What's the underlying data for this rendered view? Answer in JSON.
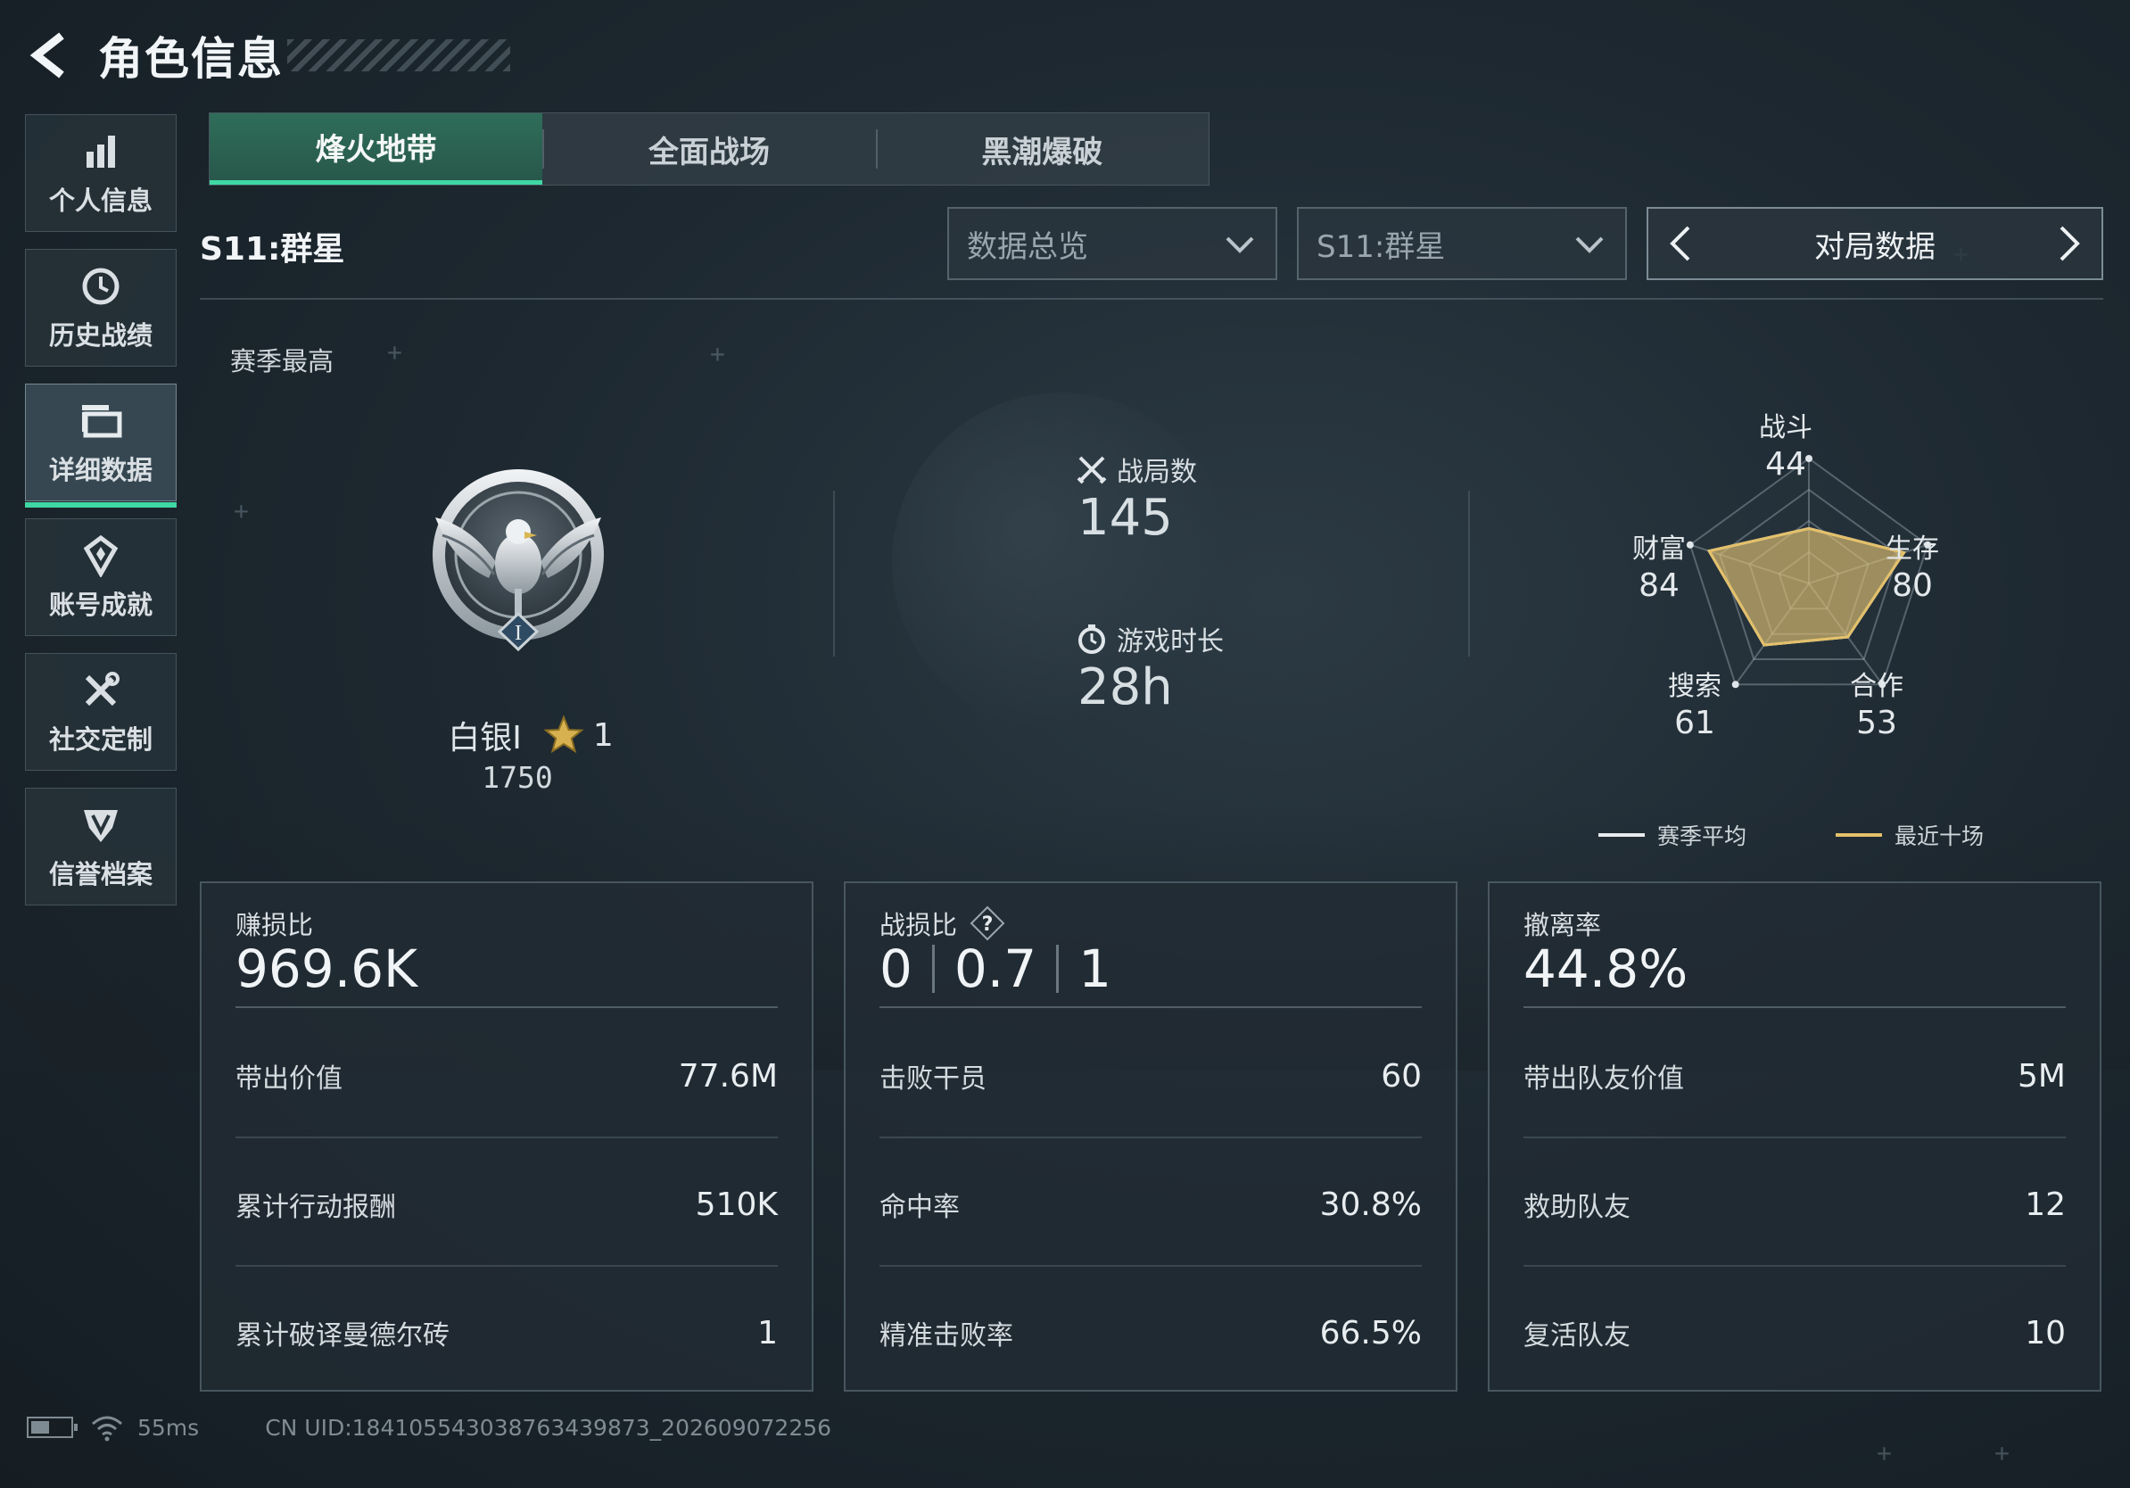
{
  "header": {
    "title": "角色信息"
  },
  "sidebar": {
    "items": [
      {
        "label": "个人信息",
        "icon": "bar-chart-icon"
      },
      {
        "label": "历史战绩",
        "icon": "history-clock-icon"
      },
      {
        "label": "详细数据",
        "icon": "folder-icon",
        "active": true
      },
      {
        "label": "账号成就",
        "icon": "achievement-icon"
      },
      {
        "label": "社交定制",
        "icon": "tools-icon"
      },
      {
        "label": "信誉档案",
        "icon": "shield-emblem-icon"
      }
    ]
  },
  "tabs": [
    {
      "label": "烽火地带",
      "active": true
    },
    {
      "label": "全面战场"
    },
    {
      "label": "黑潮爆破"
    }
  ],
  "filters": {
    "season_title": "S11:群星",
    "overview_dropdown": "数据总览",
    "season_dropdown": "S11:群星",
    "pager_label": "对局数据"
  },
  "summary": {
    "season_best_label": "赛季最高",
    "rank_name": "白银I",
    "rank_stars": "1",
    "rank_score": "1750",
    "matches_label": "战局数",
    "matches_value": "145",
    "playtime_label": "游戏时长",
    "playtime_value": "28h"
  },
  "radar": {
    "axes": [
      {
        "name": "战斗",
        "value": "44"
      },
      {
        "name": "生存",
        "value": "80"
      },
      {
        "name": "合作",
        "value": "53"
      },
      {
        "name": "搜索",
        "value": "61"
      },
      {
        "name": "财富",
        "value": "84"
      }
    ],
    "legend": {
      "season_avg": "赛季平均",
      "recent_ten": "最近十场"
    },
    "colors": {
      "season_avg": "#e8ecef",
      "recent_ten": "#e3c06a"
    }
  },
  "cards": {
    "profit": {
      "title": "赚损比",
      "value": "969.6K",
      "rows": [
        {
          "label": "带出价值",
          "value": "77.6M"
        },
        {
          "label": "累计行动报酬",
          "value": "510K"
        },
        {
          "label": "累计破译曼德尔砖",
          "value": "1"
        }
      ]
    },
    "combat": {
      "title": "战损比",
      "values": [
        "0",
        "0.7",
        "1"
      ],
      "rows": [
        {
          "label": "击败干员",
          "value": "60"
        },
        {
          "label": "命中率",
          "value": "30.8%"
        },
        {
          "label": "精准击败率",
          "value": "66.5%"
        }
      ]
    },
    "extract": {
      "title": "撤离率",
      "value": "44.8%",
      "rows": [
        {
          "label": "带出队友价值",
          "value": "5M"
        },
        {
          "label": "救助队友",
          "value": "12"
        },
        {
          "label": "复活队友",
          "value": "10"
        }
      ]
    }
  },
  "footer": {
    "ping": "55ms",
    "uid": "CN UID:184105543038763439873_202609072256",
    "battery_level": 0.45
  },
  "colors": {
    "accent": "#3fd8a4",
    "tab_active_bg": "#2f6d5a",
    "rank_gold": "#d7b150"
  }
}
